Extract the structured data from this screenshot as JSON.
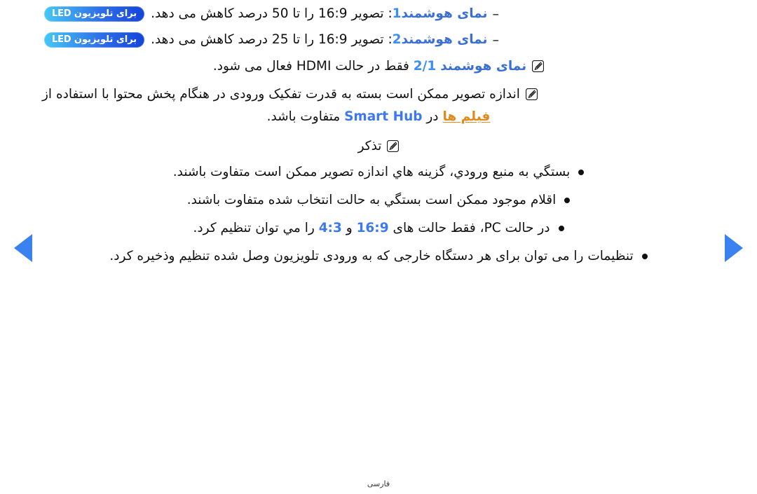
{
  "document": {
    "language_label": "فارسی",
    "direction": "rtl"
  },
  "badge": {
    "prefix": "برای تلویزیون",
    "led": "LED"
  },
  "notes": {
    "dash_marker": "–",
    "bullet_marker": "•",
    "note_icon_name": "note-pencil-icon"
  },
  "lines": {
    "smart_view_1": {
      "label": "نمای هوشمند",
      "number": "1",
      "colon": ":",
      "text_before": "تصویر",
      "ratio": "16:9",
      "text_mid": "را تا",
      "percent": "50",
      "text_after": "درصد کاهش می دهد."
    },
    "smart_view_2": {
      "label": "نمای هوشمند",
      "number": "2",
      "colon": ":",
      "text_before": "تصویر",
      "ratio": "16:9",
      "text_mid": "را تا",
      "percent": "25",
      "text_after": "درصد کاهش می دهد."
    },
    "hdmi_note": {
      "label": "نمای هوشمند",
      "number": "2/1",
      "text_before": "فقط در حالت",
      "mode": "HDMI",
      "text_after": "فعال می شود."
    },
    "resolution_note": {
      "part_1": "اندازه تصویر ممکن است بسته به قدرت تفکیک ورودی در  هنگام پخش محتوا با استفاده از",
      "films_link": "فیلم ها",
      "in_word": "در",
      "smart_hub": "Smart Hub",
      "part_2": "متفاوت باشد."
    },
    "note_heading": "تذکر"
  },
  "bullets": [
    {
      "text": "بستگي به منبع ورودي، گزينه هاي اندازه تصوير ممکن است متفاوت باشند."
    },
    {
      "text": "اقلام موجود ممکن است بستگي به حالت انتخاب شده متفاوت باشند."
    },
    {
      "text_before": "در حالت",
      "mode": "PC",
      "text_mid": "، فقط حالت های",
      "ratio_a": "16:9",
      "conj": "و",
      "ratio_b": "4:3",
      "text_after": "را مي توان تنظیم کرد."
    },
    {
      "text": "تنظیمات را می توان برای هر دستگاه خارجی که به ورودی تلویزیون وصل شده تنظیم وذخیره کرد."
    }
  ],
  "navigation": {
    "prev_label": "صفحه قبل",
    "next_label": "صفحه بعد",
    "arrow_color": "#3b82f1"
  },
  "colors": {
    "heading_blue": "#3b6fd4",
    "accent_blue": "#3c8ef5",
    "link_orange": "#e08a1e",
    "badge_gradient_start": "#46c8f5",
    "badge_gradient_end": "#1344d8",
    "text": "#151515"
  }
}
